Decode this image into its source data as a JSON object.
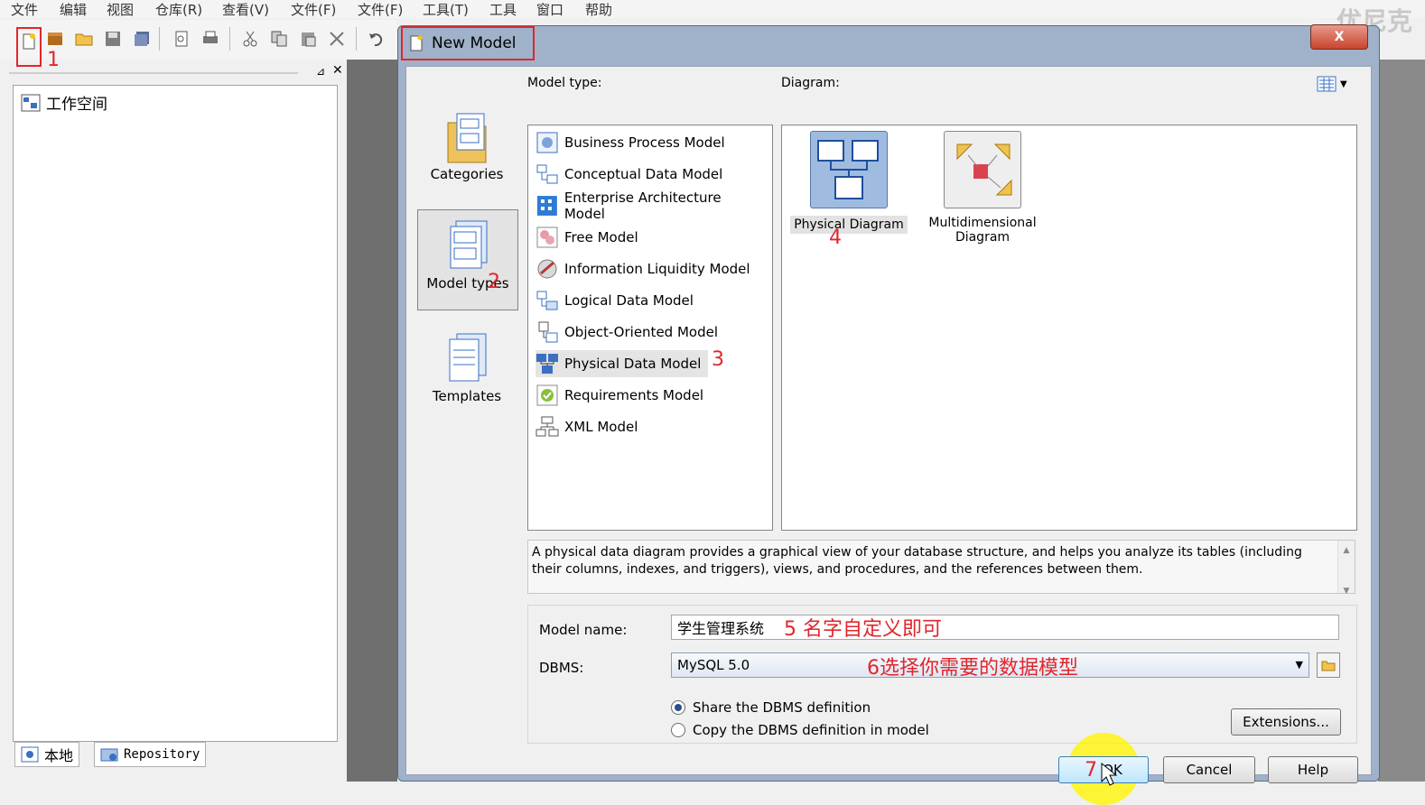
{
  "app": {
    "menu": [
      "文件",
      "编辑",
      "视图",
      "仓库(R)",
      "查看(V)",
      "文件(F)",
      "文件(F)",
      "工具(T)",
      "工具",
      "窗口",
      "帮助"
    ],
    "watermark": "优尼克",
    "workspace_label": "工作空间",
    "tabs": [
      "本地",
      "Repository"
    ]
  },
  "dialog": {
    "title": "New Model",
    "close_symbol": "X",
    "model_type_label": "Model type:",
    "diagram_label": "Diagram:",
    "categories": [
      {
        "label": "Categories",
        "icon": "categories-icon",
        "selected": false
      },
      {
        "label": "Model types",
        "icon": "model-types-icon",
        "selected": true
      },
      {
        "label": "Templates",
        "icon": "templates-icon",
        "selected": false
      }
    ],
    "model_types": [
      {
        "label": "Business Process Model",
        "icon": "business-process-icon"
      },
      {
        "label": "Conceptual Data Model",
        "icon": "conceptual-data-icon"
      },
      {
        "label": "Enterprise Architecture Model",
        "icon": "enterprise-architecture-icon"
      },
      {
        "label": "Free Model",
        "icon": "free-model-icon"
      },
      {
        "label": "Information Liquidity Model",
        "icon": "information-liquidity-icon"
      },
      {
        "label": "Logical Data Model",
        "icon": "logical-data-icon"
      },
      {
        "label": "Object-Oriented Model",
        "icon": "object-oriented-icon"
      },
      {
        "label": "Physical Data Model",
        "icon": "physical-data-icon",
        "selected": true
      },
      {
        "label": "Requirements Model",
        "icon": "requirements-icon"
      },
      {
        "label": "XML Model",
        "icon": "xml-model-icon"
      }
    ],
    "diagrams": [
      {
        "label": "Physical Diagram",
        "icon": "physical-diagram-icon",
        "selected": true
      },
      {
        "label": "Multidimensional Diagram",
        "icon": "multidimensional-diagram-icon"
      }
    ],
    "description": "A physical data diagram provides a graphical view of your database structure, and helps you analyze its tables (including their columns, indexes, and triggers), views, and procedures, and the references between them.",
    "model_name_label": "Model name:",
    "model_name_value": "学生管理系统",
    "dbms_label": "DBMS:",
    "dbms_value": "MySQL 5.0",
    "radio_share": "Share the DBMS definition",
    "radio_copy": "Copy the DBMS definition in model",
    "extensions_btn": "Extensions...",
    "ok_btn": "OK",
    "cancel_btn": "Cancel",
    "help_btn": "Help"
  },
  "annotations": {
    "n1": "1",
    "n2": "2",
    "n3": "3",
    "n4": "4",
    "n5": "5 名字自定义即可",
    "n6": "6选择你需要的数据模型",
    "n7": "7"
  },
  "colors": {
    "annotation_red": "#e0262d",
    "highlight_yellow": "#fff500"
  }
}
